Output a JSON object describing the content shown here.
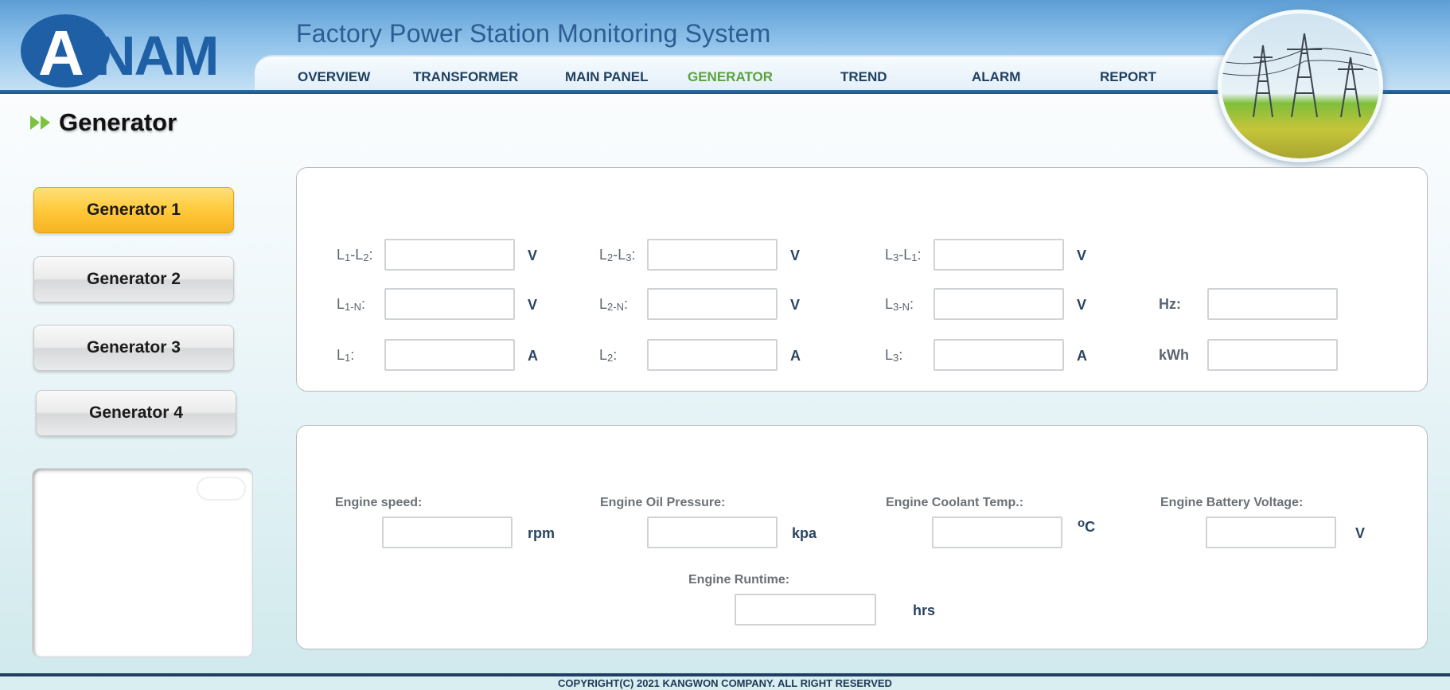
{
  "header": {
    "logo_text": "ANAM",
    "app_title": "Factory Power Station Monitoring System",
    "nav": [
      {
        "label": "OVERVIEW",
        "active": false
      },
      {
        "label": "TRANSFORMER",
        "active": false
      },
      {
        "label": "MAIN PANEL",
        "active": false
      },
      {
        "label": "GENERATOR",
        "active": true
      },
      {
        "label": "TREND",
        "active": false
      },
      {
        "label": "ALARM",
        "active": false
      },
      {
        "label": "REPORT",
        "active": false
      }
    ],
    "hero_image": "power-transmission-towers-over-cornfield"
  },
  "page": {
    "title": "Generator",
    "heading_icon": "double-arrow-right-icon"
  },
  "sidebar": {
    "generators": [
      {
        "label": "Generator 1",
        "active": true
      },
      {
        "label": "Generator 2",
        "active": false
      },
      {
        "label": "Generator 3",
        "active": false
      },
      {
        "label": "Generator 4",
        "active": false
      }
    ]
  },
  "electrical": {
    "rows": [
      [
        {
          "label_main": "L",
          "label_sub": "1",
          "label_rest": "-L",
          "label_sub2": "2",
          "label_end": ":",
          "value": "",
          "unit": "V"
        },
        {
          "label_main": "L",
          "label_sub": "2",
          "label_rest": "-L",
          "label_sub2": "3",
          "label_end": ":",
          "value": "",
          "unit": "V"
        },
        {
          "label_main": "L",
          "label_sub": "3",
          "label_rest": "-L",
          "label_sub2": "1",
          "label_end": ":",
          "value": "",
          "unit": "V"
        }
      ],
      [
        {
          "label_main": "L",
          "label_sub": "1-N",
          "label_rest": "",
          "label_sub2": "",
          "label_end": ":",
          "value": "",
          "unit": "V"
        },
        {
          "label_main": "L",
          "label_sub": "2-N",
          "label_rest": "",
          "label_sub2": "",
          "label_end": ":",
          "value": "",
          "unit": "V"
        },
        {
          "label_main": "L",
          "label_sub": "3-N",
          "label_rest": "",
          "label_sub2": "",
          "label_end": ":",
          "value": "",
          "unit": "V"
        },
        {
          "label_main": "Hz:",
          "label_sub": "",
          "label_rest": "",
          "label_sub2": "",
          "label_end": "",
          "value": "",
          "unit": ""
        }
      ],
      [
        {
          "label_main": "L",
          "label_sub": "1",
          "label_rest": "",
          "label_sub2": "",
          "label_end": ":",
          "value": "",
          "unit": "A"
        },
        {
          "label_main": "L",
          "label_sub": "2",
          "label_rest": "",
          "label_sub2": "",
          "label_end": ":",
          "value": "",
          "unit": "A"
        },
        {
          "label_main": "L",
          "label_sub": "3",
          "label_rest": "",
          "label_sub2": "",
          "label_end": ":",
          "value": "",
          "unit": "A"
        },
        {
          "label_main": "kWh",
          "label_sub": "",
          "label_rest": "",
          "label_sub2": "",
          "label_end": "",
          "value": "",
          "unit": ""
        }
      ]
    ]
  },
  "engine": {
    "speed": {
      "label": "Engine speed:",
      "value": "",
      "unit": "rpm"
    },
    "oil_pressure": {
      "label": "Engine Oil Pressure:",
      "value": "",
      "unit": "kpa"
    },
    "coolant_temp": {
      "label": "Engine Coolant Temp.:",
      "value": "",
      "unit_sup": "o",
      "unit": "C"
    },
    "battery_voltage": {
      "label": "Engine Battery Voltage:",
      "value": "",
      "unit": "V"
    },
    "runtime": {
      "label": "Engine Runtime:",
      "value": "",
      "unit": "hrs"
    }
  },
  "footer": {
    "copyright": "COPYRIGHT(C) 2021 KANGWON COMPANY. ALL RIGHT RESERVED"
  }
}
